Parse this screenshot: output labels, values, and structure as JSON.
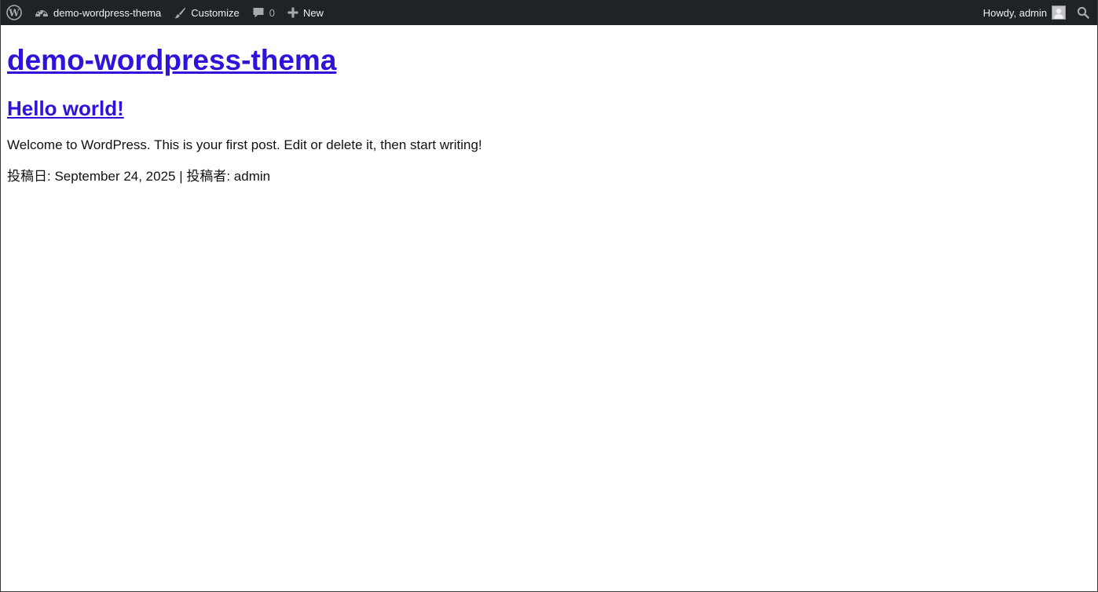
{
  "adminbar": {
    "site_name": "demo-wordpress-thema",
    "customize_label": "Customize",
    "comments_count": "0",
    "new_label": "New",
    "howdy_label": "Howdy, admin",
    "background": "#1d2327"
  },
  "site": {
    "title": "demo-wordpress-thema",
    "link_color": "#2e14d9"
  },
  "post": {
    "title": "Hello world!",
    "excerpt": "Welcome to WordPress. This is your first post. Edit or delete it, then start writing!",
    "meta": "投稿日: September 24, 2025 | 投稿者: admin"
  },
  "icons": {
    "wp_logo": "wordpress-logo-icon",
    "dashboard": "dashboard-icon",
    "customize": "paintbrush-icon",
    "comments": "comment-bubble-icon",
    "new": "plus-icon",
    "search": "search-icon"
  }
}
